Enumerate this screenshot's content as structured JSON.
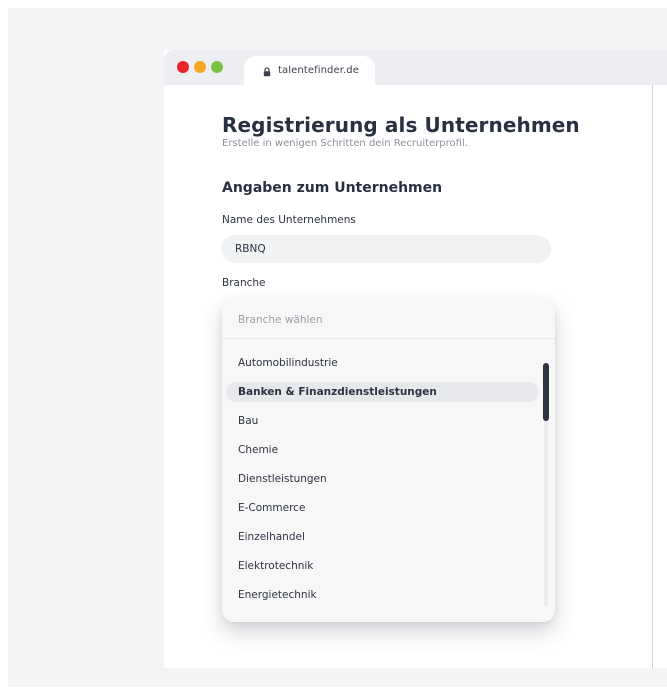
{
  "browser": {
    "url": "talentefinder.de",
    "icon": "lock-icon",
    "window_controls": [
      "close",
      "minimize",
      "maximize"
    ]
  },
  "page": {
    "title": "Registrierung als Unternehmen",
    "subtitle": "Erstelle in wenigen Schritten dein Recruiterprofil.",
    "section_title": "Angaben zum Unternehmen"
  },
  "form": {
    "company_name_label": "Name des Unternehmens",
    "company_name_value": "RBNQ",
    "branche_label": "Branche",
    "branche_placeholder": "Branche wählen"
  },
  "dropdown": {
    "options": [
      "Automobilindustrie",
      "Banken & Finanzdienstleistungen",
      "Bau",
      "Chemie",
      "Dienstleistungen",
      "E-Commerce",
      "Einzelhandel",
      "Elektrotechnik",
      "Energietechnik"
    ],
    "highlighted_index": 1
  },
  "colors": {
    "close": "#e8232a",
    "minimize": "#f5a623",
    "maximize": "#79c142",
    "scrollbar_thumb": "#2e3442"
  }
}
